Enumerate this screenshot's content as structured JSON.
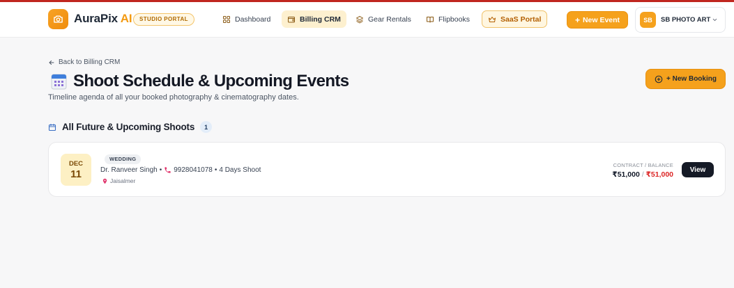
{
  "header": {
    "brand_main": "AuraPix",
    "brand_accent": "AI",
    "portal_badge": "STUDIO PORTAL",
    "nav": [
      {
        "label": "Dashboard",
        "icon": "grid-icon"
      },
      {
        "label": "Billing CRM",
        "icon": "wallet-icon",
        "active": true
      },
      {
        "label": "Gear Rentals",
        "icon": "layers-icon"
      },
      {
        "label": "Flipbooks",
        "icon": "book-icon"
      },
      {
        "label": "SaaS Portal",
        "icon": "crown-icon"
      }
    ],
    "new_event_label": "New Event",
    "account": {
      "initials": "SB",
      "name": "SB PHOTO ART"
    }
  },
  "page": {
    "back_link": "Back to Billing CRM",
    "title": "Shoot Schedule & Upcoming Events",
    "subtitle": "Timeline agenda of all your booked photography & cinematography dates.",
    "new_booking_label": "+ New Booking",
    "section_title": "All Future & Upcoming Shoots",
    "section_count": "1"
  },
  "events": [
    {
      "month": "DEC",
      "day": "11",
      "type": "WEDDING",
      "client": "Dr. Ranveer Singh",
      "phone": "9928041078",
      "duration": "4 Days Shoot",
      "location": "Jaisalmer",
      "contract_label": "CONTRACT / BALANCE",
      "contract_amount": "₹51,000",
      "balance_amount": "₹51,000",
      "view_label": "View"
    }
  ],
  "colors": {
    "accent": "#f5a11c",
    "top_line": "#c0261f",
    "balance_due": "#dc2626",
    "dark_button": "#151a26"
  }
}
